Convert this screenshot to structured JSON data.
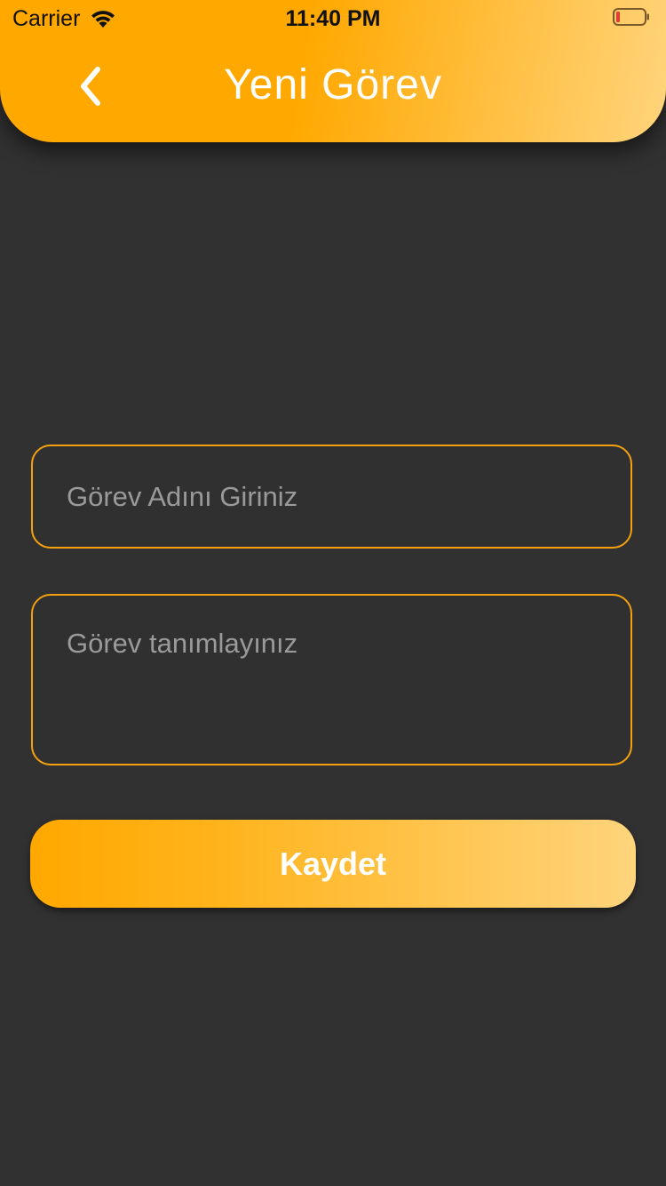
{
  "status_bar": {
    "carrier": "Carrier",
    "time": "11:40 PM",
    "icons": [
      "wifi-icon",
      "battery-icon"
    ],
    "battery_level": 0.1
  },
  "header": {
    "title": "Yeni Görev",
    "back_icon": "chevron-left-icon"
  },
  "form": {
    "task_name": {
      "value": "",
      "placeholder": "Görev Adını Giriniz"
    },
    "task_description": {
      "value": "",
      "placeholder": "Görev tanımlayınız"
    },
    "save_label": "Kaydet"
  },
  "colors": {
    "background": "#313131",
    "accent": "#FFA800",
    "accent_light": "#FFD47C",
    "field_border": "#F5A10F",
    "battery_low": "#E53935"
  }
}
